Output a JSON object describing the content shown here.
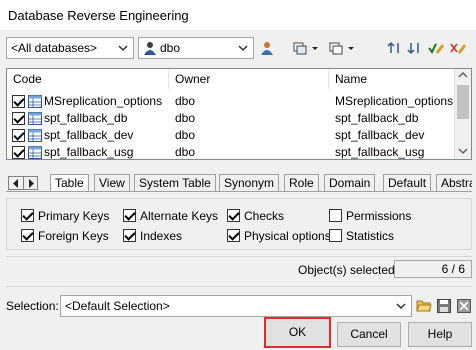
{
  "window": {
    "title": "Database Reverse Engineering"
  },
  "toolbar": {
    "database_value": "<All databases>",
    "owner_value": "dbo"
  },
  "grid": {
    "columns": [
      "Code",
      "Owner",
      "Name"
    ],
    "rows": [
      {
        "code": "MSreplication_options",
        "owner": "dbo",
        "name": "MSreplication_options",
        "checked": true
      },
      {
        "code": "spt_fallback_db",
        "owner": "dbo",
        "name": "spt_fallback_db",
        "checked": true
      },
      {
        "code": "spt_fallback_dev",
        "owner": "dbo",
        "name": "spt_fallback_dev",
        "checked": true
      },
      {
        "code": "spt_fallback_usg",
        "owner": "dbo",
        "name": "spt_fallback_usg",
        "checked": true
      }
    ]
  },
  "tabs": [
    "Table",
    "View",
    "System Table",
    "Synonym",
    "Role",
    "Domain",
    "Default",
    "Abstra"
  ],
  "options": [
    {
      "label": "Primary Keys",
      "checked": true
    },
    {
      "label": "Alternate Keys",
      "checked": true
    },
    {
      "label": "Checks",
      "checked": true
    },
    {
      "label": "Permissions",
      "checked": false
    },
    {
      "label": "Foreign Keys",
      "checked": true
    },
    {
      "label": "Indexes",
      "checked": true
    },
    {
      "label": "Physical options",
      "checked": true
    },
    {
      "label": "Statistics",
      "checked": false
    }
  ],
  "status": {
    "label": "Object(s) selected:",
    "value": "6 / 6"
  },
  "selection": {
    "label": "Selection:",
    "value": "<Default Selection>"
  },
  "buttons": {
    "ok": "OK",
    "cancel": "Cancel",
    "help": "Help"
  }
}
